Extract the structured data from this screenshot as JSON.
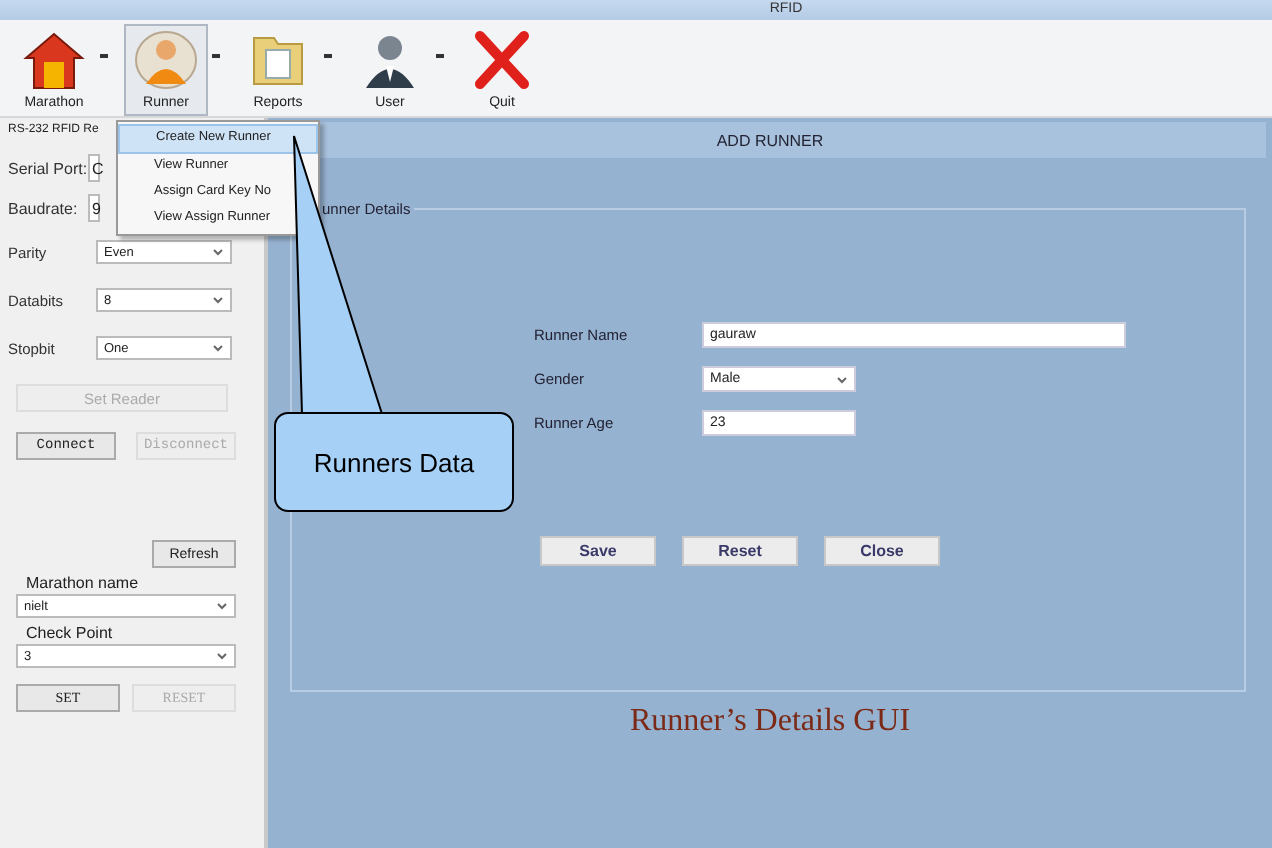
{
  "window": {
    "title": "RFID"
  },
  "toolbar": [
    {
      "label": "Marathon",
      "kind": "house",
      "selected": false,
      "dropdown": true
    },
    {
      "label": "Runner",
      "kind": "runner",
      "selected": true,
      "dropdown": true
    },
    {
      "label": "Reports",
      "kind": "folder",
      "selected": false,
      "dropdown": true
    },
    {
      "label": "User",
      "kind": "user",
      "selected": false,
      "dropdown": true
    },
    {
      "label": "Quit",
      "kind": "quit",
      "selected": false,
      "dropdown": false
    }
  ],
  "runner_menu": [
    {
      "label": "Create New Runner",
      "selected": true
    },
    {
      "label": "View Runner",
      "selected": false
    },
    {
      "label": "Assign Card Key No",
      "selected": false
    },
    {
      "label": "View Assign Runner",
      "selected": false
    }
  ],
  "reader_panel": {
    "title": "RS-232 RFID Re",
    "settings": [
      {
        "label": "Serial Port:",
        "value": "C",
        "kind": "covered"
      },
      {
        "label": "Baudrate:",
        "value": "9",
        "kind": "covered"
      },
      {
        "label": "Parity",
        "value": "Even",
        "kind": "select"
      },
      {
        "label": "Databits",
        "value": "8",
        "kind": "select"
      },
      {
        "label": "Stopbit",
        "value": "One",
        "kind": "select"
      }
    ],
    "set_reader": {
      "label": "Set Reader",
      "disabled": true
    },
    "connection": [
      {
        "label": "Connect",
        "disabled": false
      },
      {
        "label": "Disconnect",
        "disabled": true
      }
    ],
    "refresh": "Refresh",
    "marathon_name": {
      "label": "Marathon name",
      "value": "nielt"
    },
    "check_point": {
      "label": "Check Point",
      "value": "3"
    },
    "actions": [
      {
        "label": "SET",
        "disabled": false
      },
      {
        "label": "RESET",
        "disabled": true
      }
    ]
  },
  "form": {
    "header": "ADD RUNNER",
    "group_title": "unner Details",
    "fields": [
      {
        "label": "Runner Name",
        "kind": "text",
        "value": "gauraw"
      },
      {
        "label": "Gender",
        "kind": "select",
        "value": "Male"
      },
      {
        "label": "Runner Age",
        "kind": "short",
        "value": "23"
      }
    ],
    "buttons": [
      "Save",
      "Reset",
      "Close"
    ]
  },
  "callout": {
    "text": "Runners Data"
  },
  "caption": "Runner’s Details GUI"
}
